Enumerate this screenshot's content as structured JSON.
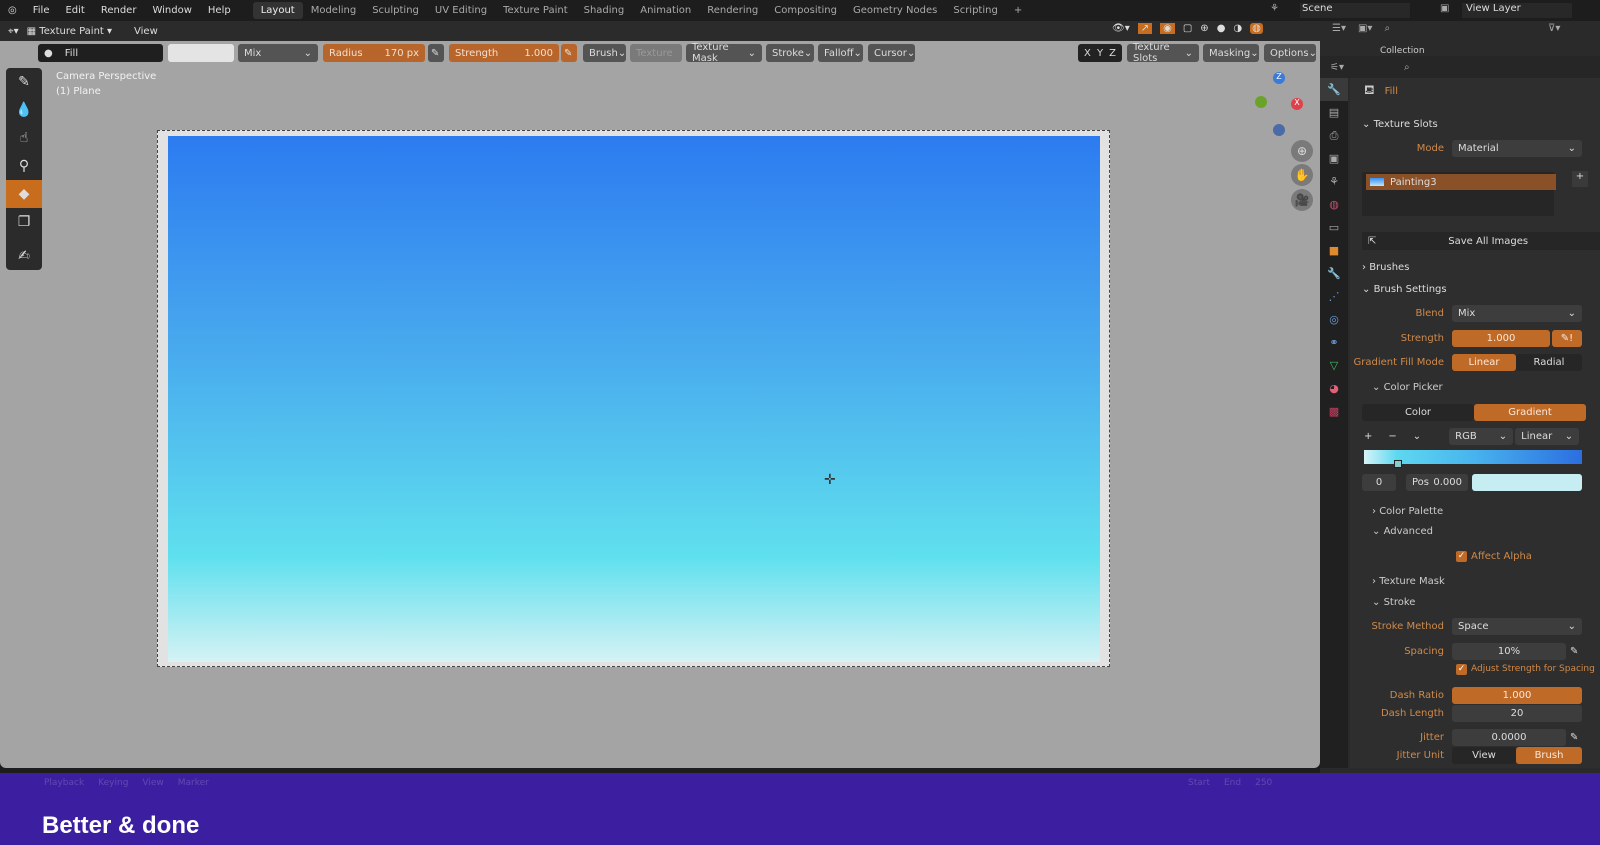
{
  "menu": [
    "File",
    "Edit",
    "Render",
    "Window",
    "Help"
  ],
  "workspaces": [
    "Layout",
    "Modeling",
    "Sculpting",
    "UV Editing",
    "Texture Paint",
    "Shading",
    "Animation",
    "Rendering",
    "Compositing",
    "Geometry Nodes",
    "Scripting",
    "+"
  ],
  "scene": "Scene",
  "view_layer": "View Layer",
  "header": {
    "mode": "Texture Paint",
    "view": "View"
  },
  "toolsettings": {
    "brush": "Fill",
    "blend": "Mix",
    "radius_label": "Radius",
    "radius": "170 px",
    "strength_label": "Strength",
    "strength": "1.000",
    "brush_menu": "Brush",
    "texture": "Texture",
    "texture_mask": "Texture Mask",
    "stroke": "Stroke",
    "falloff": "Falloff",
    "cursor": "Cursor",
    "x": "X",
    "y": "Y",
    "z": "Z",
    "texture_slots": "Texture Slots",
    "masking": "Masking",
    "options": "Options"
  },
  "viewport": {
    "camera": "Camera Perspective",
    "object": "(1) Plane"
  },
  "outliner": {
    "collection": "Collection"
  },
  "props": {
    "brush_name": "Fill",
    "texture_slots": "Texture Slots",
    "mode_label": "Mode",
    "mode": "Material",
    "slot": "Painting3",
    "save_all": "Save All Images",
    "brushes": "Brushes",
    "brush_settings": "Brush Settings",
    "blend_label": "Blend",
    "blend": "Mix",
    "strength_label": "Strength",
    "strength": "1.000",
    "gradient_fill_label": "Gradient Fill Mode",
    "linear": "Linear",
    "radial": "Radial",
    "color_picker": "Color Picker",
    "color": "Color",
    "gradient": "Gradient",
    "plus": "+",
    "minus": "−",
    "rgb": "RGB",
    "interp": "Linear",
    "stop_index": "0",
    "pos_label": "Pos",
    "pos": "0.000",
    "color_palette": "Color Palette",
    "advanced": "Advanced",
    "affect_alpha": "Affect Alpha",
    "texture_mask": "Texture Mask",
    "stroke": "Stroke",
    "stroke_method_label": "Stroke Method",
    "stroke_method": "Space",
    "spacing_label": "Spacing",
    "spacing": "10%",
    "adjust_strength": "Adjust Strength for Spacing",
    "dash_ratio_label": "Dash Ratio",
    "dash_ratio": "1.000",
    "dash_length_label": "Dash Length",
    "dash_length": "20",
    "jitter_label": "Jitter",
    "jitter": "0.0000",
    "jitter_unit_label": "Jitter Unit",
    "view": "View",
    "brush": "Brush"
  },
  "timeline": {
    "playback": "Playback",
    "keying": "Keying",
    "view": "View",
    "marker": "Marker",
    "start": "Start",
    "end": "End",
    "end_val": "250"
  },
  "caption": "Better & done",
  "colors": {
    "accent": "#c06a28",
    "overlay": "#3c1fa0"
  }
}
